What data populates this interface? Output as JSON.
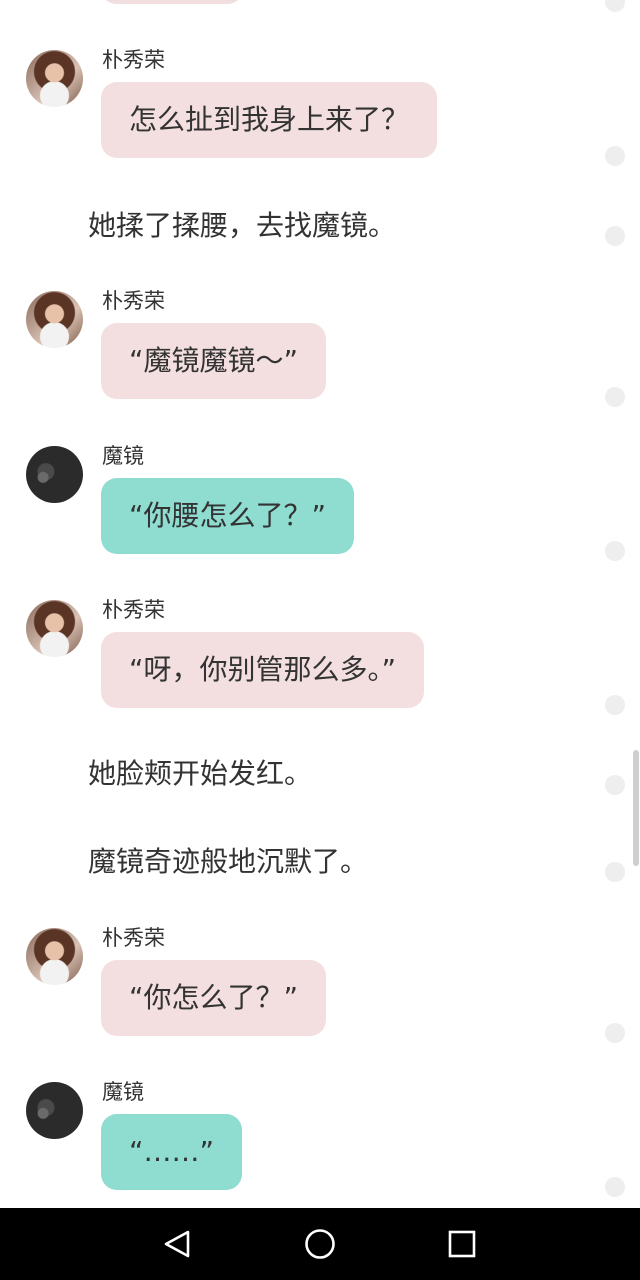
{
  "chat": {
    "messages": [
      {
        "type": "chat",
        "sender": "朴秀荣",
        "avatar": "girl-avatar",
        "bubble_color": "pink",
        "text": "怎么扯到我身上来了？"
      },
      {
        "type": "narration",
        "text": "她揉了揉腰，去找魔镜。"
      },
      {
        "type": "chat",
        "sender": "朴秀荣",
        "avatar": "girl-avatar",
        "bubble_color": "pink",
        "text": "“魔镜魔镜～”"
      },
      {
        "type": "chat",
        "sender": "魔镜",
        "avatar": "mirror-avatar",
        "bubble_color": "teal",
        "text": "“你腰怎么了？”"
      },
      {
        "type": "chat",
        "sender": "朴秀荣",
        "avatar": "girl-avatar",
        "bubble_color": "pink",
        "text": "“呀，你别管那么多。”"
      },
      {
        "type": "narration",
        "text": "她脸颊开始发红。"
      },
      {
        "type": "narration",
        "text": "魔镜奇迹般地沉默了。"
      },
      {
        "type": "chat",
        "sender": "朴秀荣",
        "avatar": "girl-avatar",
        "bubble_color": "pink",
        "text": "“你怎么了？”"
      },
      {
        "type": "chat",
        "sender": "魔镜",
        "avatar": "mirror-avatar",
        "bubble_color": "teal",
        "text": "“……”"
      }
    ]
  },
  "colors": {
    "pink_bubble": "#f3dfdf",
    "teal_bubble": "#8fdcd1",
    "text": "#333333",
    "navbar": "#000000"
  },
  "navbar": {
    "buttons": [
      {
        "icon": "back-triangle-icon"
      },
      {
        "icon": "home-circle-icon"
      },
      {
        "icon": "recents-square-icon"
      }
    ]
  }
}
